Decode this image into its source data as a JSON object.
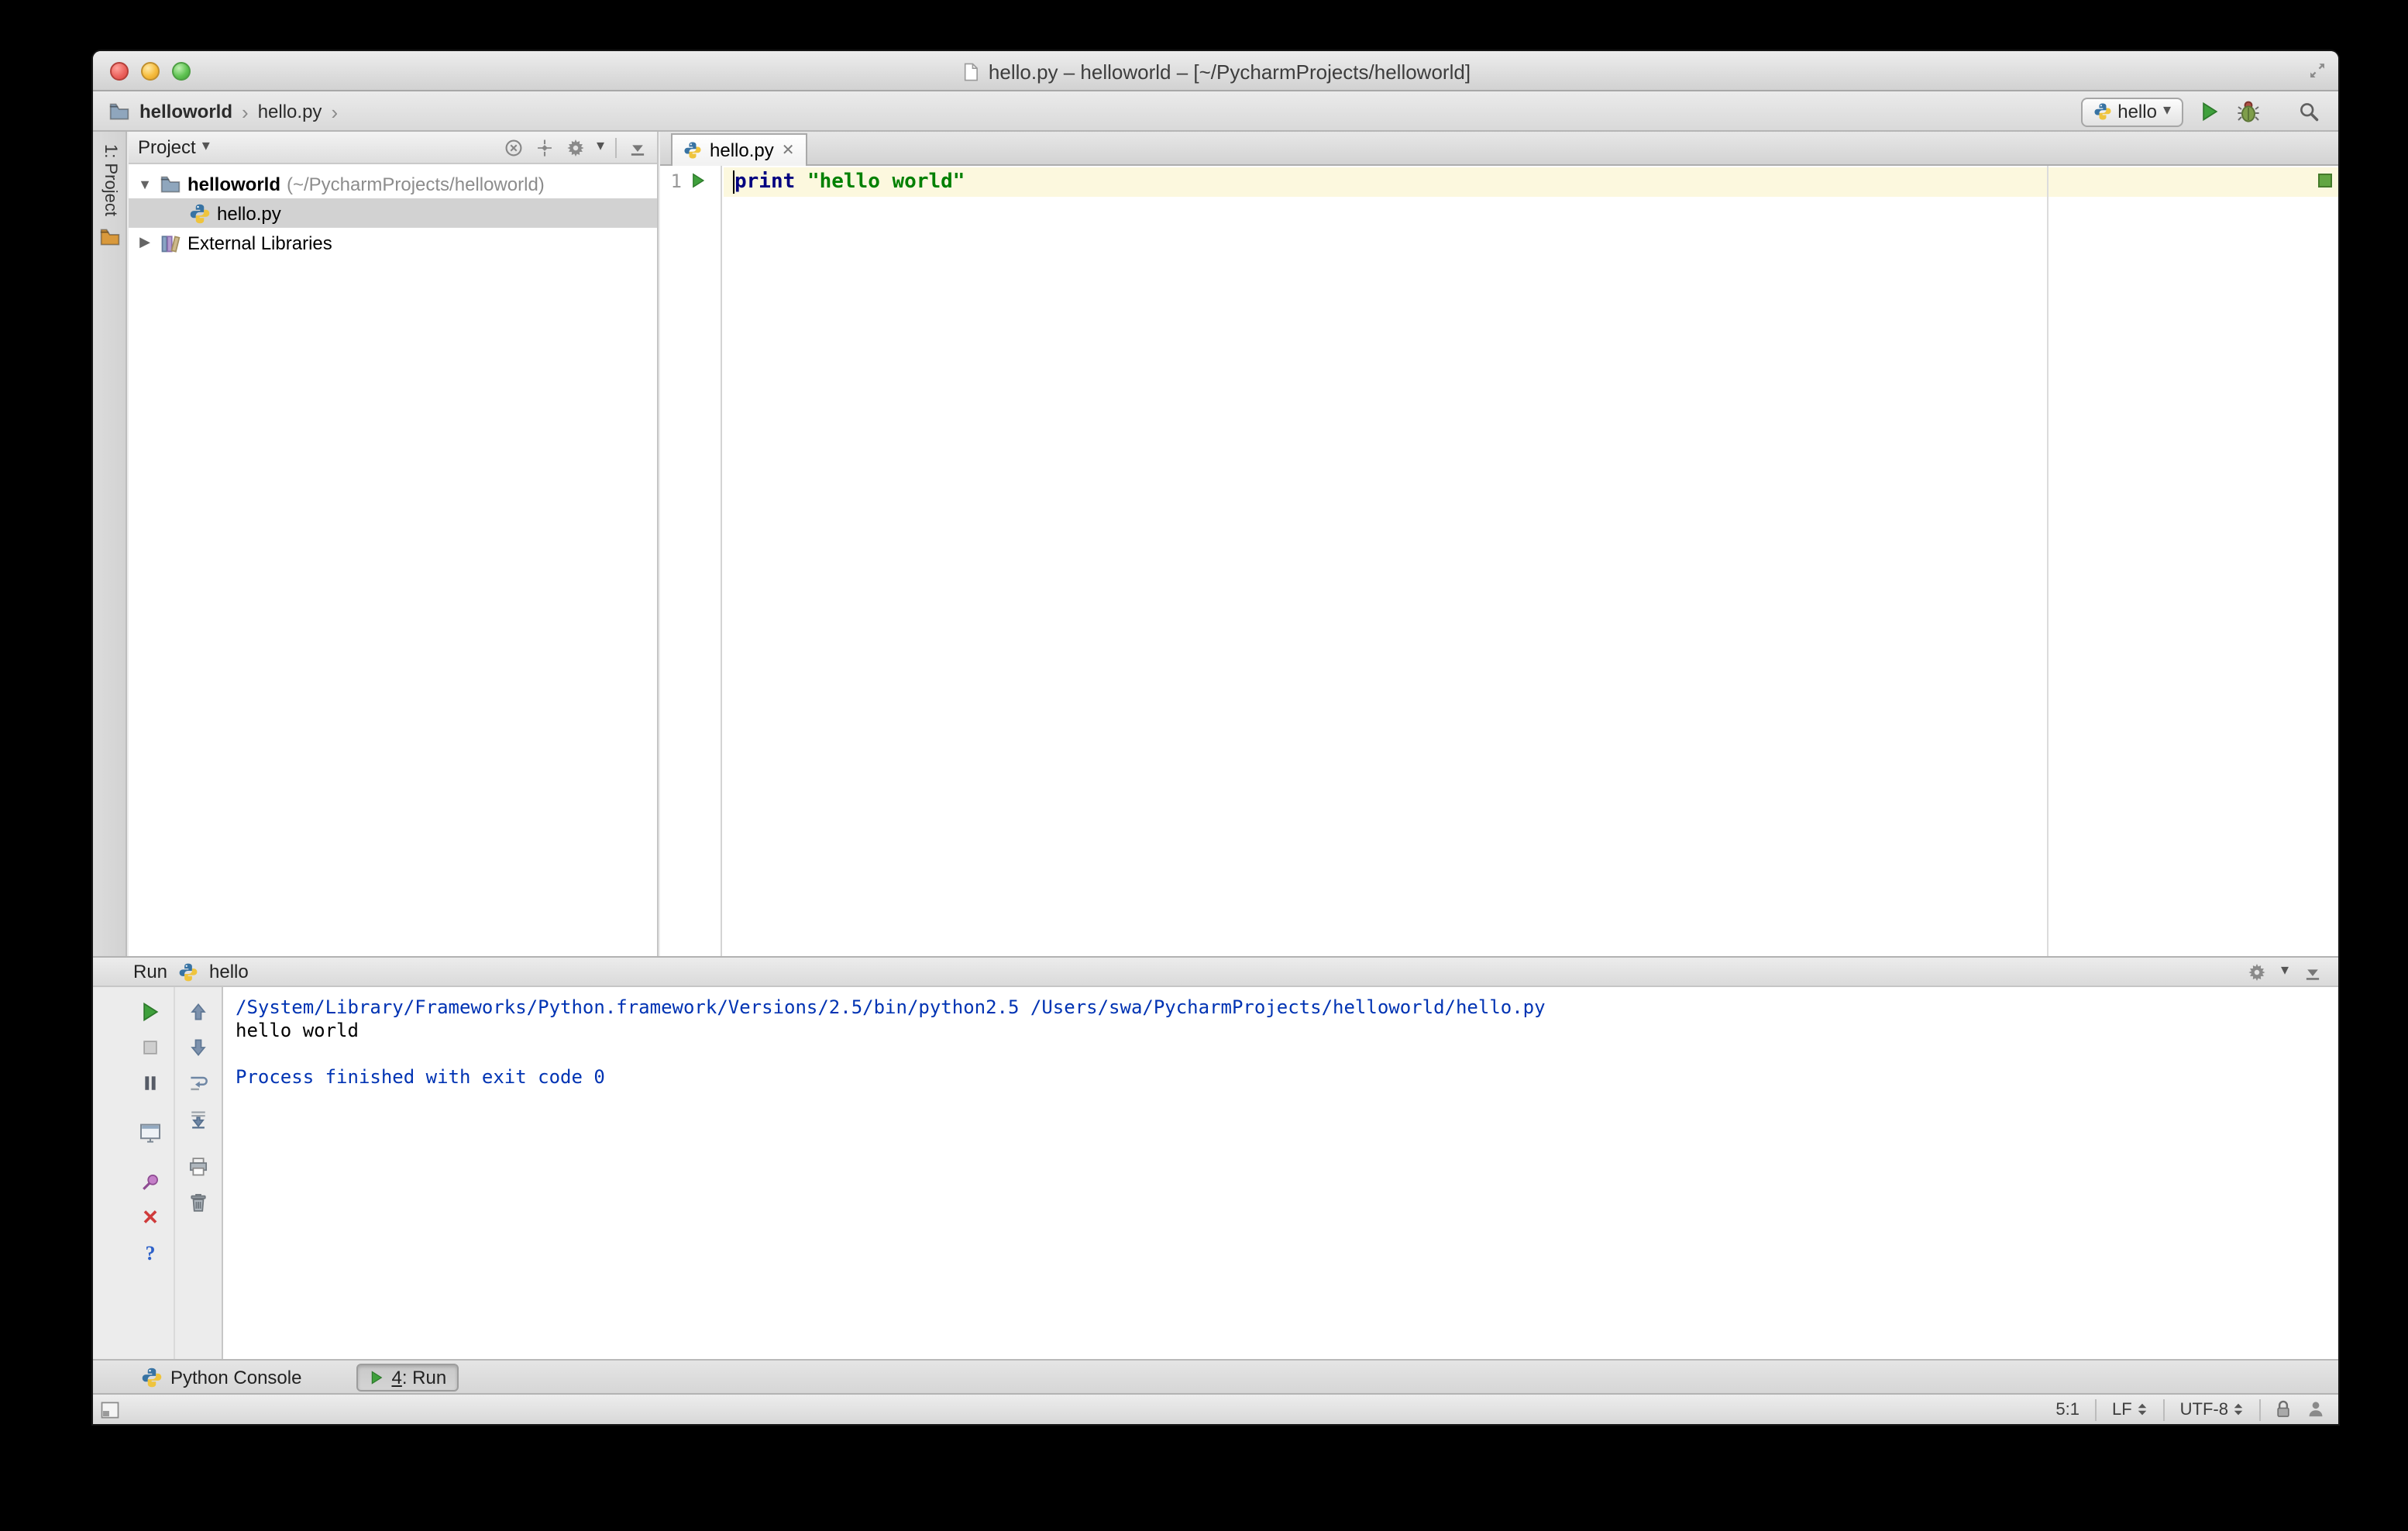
{
  "window": {
    "title": "hello.py – helloworld – [~/PycharmProjects/helloworld]"
  },
  "navbar": {
    "project_crumb": "helloworld",
    "file_crumb": "hello.py",
    "run_config_label": "hello"
  },
  "tool_stripe": {
    "project_button": "1: Project"
  },
  "project_panel": {
    "header_title": "Project",
    "root_label": "helloworld",
    "root_path": "(~/PycharmProjects/helloworld)",
    "file_label": "hello.py",
    "libraries_label": "External Libraries"
  },
  "editor": {
    "tab_label": "hello.py",
    "line_number": "1",
    "code_keyword": "print",
    "code_space": " ",
    "code_string": "\"hello world\""
  },
  "run_panel": {
    "header_label": "Run",
    "config_label": "hello",
    "toolbar_left": [
      "rerun",
      "stop",
      "pause-output",
      "restore-layout",
      "pin-tab",
      "close",
      "help"
    ],
    "toolbar_right": [
      "up-stack-trace",
      "down-stack-trace",
      "soft-wrap",
      "scroll-to-end",
      "print",
      "clear-all"
    ],
    "console_lines": [
      {
        "text": "/System/Library/Frameworks/Python.framework/Versions/2.5/bin/python2.5 /Users/swa/PycharmProjects/helloworld/hello.py",
        "stream": "system"
      },
      {
        "text": "hello world",
        "stream": "stdout"
      },
      {
        "text": "",
        "stream": "stdout"
      },
      {
        "text": "Process finished with exit code 0",
        "stream": "system"
      }
    ]
  },
  "bottom_bar": {
    "python_console_label": "Python Console",
    "run_tab_mnemonic": "4",
    "run_tab_rest": ": Run"
  },
  "status_bar": {
    "caret_position": "5:1",
    "line_separator": "LF",
    "encoding": "UTF-8"
  },
  "colors": {
    "keyword": "#000080",
    "string": "#008000",
    "console_system": "#0033b3",
    "run_green": "#3fa03c",
    "caret_line": "#fcf8de"
  },
  "glyphs": {
    "chevron": "›",
    "dropdown": "▾",
    "expanded": "▼",
    "collapsed": "▶",
    "close_x": "✕",
    "help": "?"
  }
}
